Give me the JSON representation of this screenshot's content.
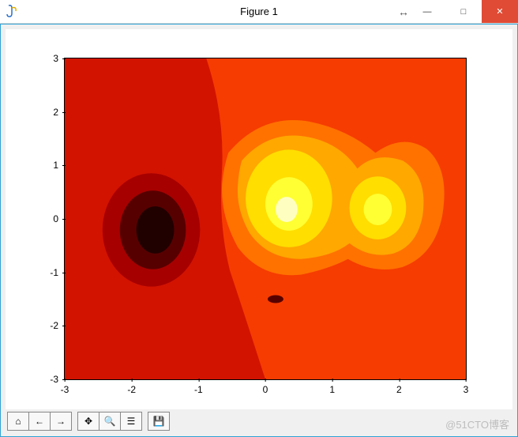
{
  "window": {
    "title": "Figure 1",
    "resize_glyph": "↔",
    "minimize_glyph": "—",
    "maximize_glyph": "□",
    "close_glyph": "✕"
  },
  "toolbar": {
    "home": "⌂",
    "back": "←",
    "forward": "→",
    "pan": "✥",
    "zoom": "🔍",
    "configure": "☰",
    "save": "💾"
  },
  "watermark": "@51CTO博客",
  "chart_data": {
    "type": "contourf",
    "title": "",
    "xlabel": "",
    "ylabel": "",
    "xlim": [
      -3,
      3
    ],
    "ylim": [
      -3,
      3
    ],
    "xticks": [
      -3,
      -2,
      -1,
      0,
      1,
      2,
      3
    ],
    "yticks": [
      -3,
      -2,
      -1,
      0,
      1,
      2,
      3
    ],
    "colormap": "hot",
    "levels": [
      -1.2,
      -0.9,
      -0.6,
      -0.3,
      0.0,
      0.3,
      0.6,
      0.9,
      1.2,
      1.5,
      1.8
    ],
    "level_colors": [
      "#210000",
      "#570000",
      "#a70000",
      "#d21300",
      "#f63c00",
      "#ff7200",
      "#ffa800",
      "#ffde00",
      "#ffff33",
      "#fffec1"
    ],
    "function_note": "z ≈ (1-x/2 + x^5 + y^3) * exp(-x^2 - y^2) (matplotlib contourf demo with cmap='hot')",
    "features": [
      {
        "type": "minimum",
        "center_xy": [
          -1.7,
          -0.2
        ],
        "approx_value": -1.0
      },
      {
        "type": "maximum",
        "center_xy": [
          -0.1,
          0.15
        ],
        "approx_value": 1.6
      },
      {
        "type": "maximum",
        "center_xy": [
          1.5,
          0.15
        ],
        "approx_value": 1.3
      },
      {
        "type": "saddle_small_min",
        "center_xy": [
          0.15,
          -1.5
        ],
        "approx_value": -0.35
      }
    ],
    "sampled_values": [
      {
        "x": -3,
        "y": -3,
        "z": 0.0
      },
      {
        "x": -2,
        "y": -2,
        "z": -0.03
      },
      {
        "x": -2,
        "y": 0,
        "z": -0.55
      },
      {
        "x": -1.7,
        "y": -0.2,
        "z": -1.0
      },
      {
        "x": -1,
        "y": 0,
        "z": 0.18
      },
      {
        "x": 0,
        "y": 0,
        "z": 1.0
      },
      {
        "x": -0.1,
        "y": 0.15,
        "z": 1.6
      },
      {
        "x": 1,
        "y": 0,
        "z": 0.55
      },
      {
        "x": 1.5,
        "y": 0.15,
        "z": 1.3
      },
      {
        "x": 2,
        "y": 0,
        "z": 0.6
      },
      {
        "x": 0,
        "y": 1,
        "z": 0.74
      },
      {
        "x": 0,
        "y": -1,
        "z": 0.0
      },
      {
        "x": 0.15,
        "y": -1.5,
        "z": -0.35
      },
      {
        "x": 3,
        "y": 3,
        "z": 0.0
      }
    ]
  }
}
